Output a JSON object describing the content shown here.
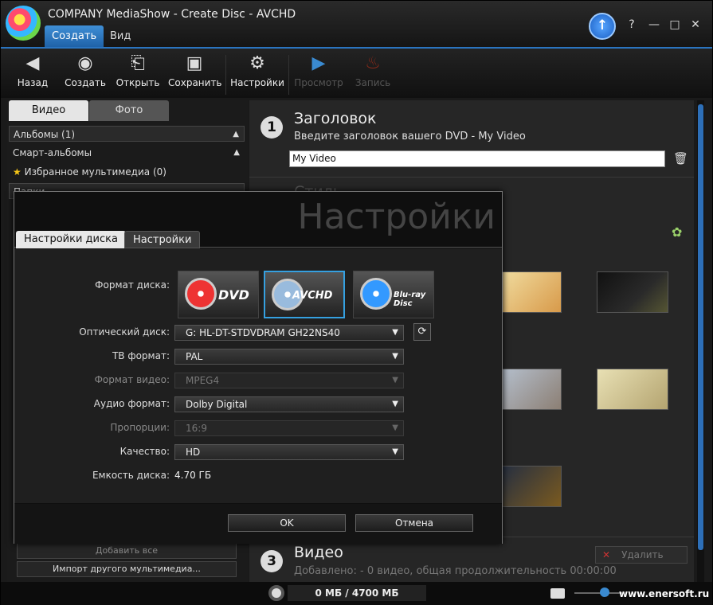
{
  "window": {
    "title": "COMPANY MediaShow - Create Disc - AVCHD",
    "help": "?",
    "minimize": "—",
    "maximize": "□",
    "close": "✕"
  },
  "menu": {
    "tab1": "Создать",
    "tab2": "Вид"
  },
  "toolbar": {
    "back": "Назад",
    "create": "Создать",
    "open": "Открыть",
    "save": "Сохранить",
    "settings": "Настройки",
    "preview": "Просмотр",
    "burn": "Запись"
  },
  "left": {
    "tab_video": "Видео",
    "tab_photo": "Фото",
    "albums": "Альбомы (1)",
    "smart_albums": "Смарт-альбомы",
    "favorites": "Избранное мультимедиа (0)",
    "folders": "Папки",
    "add_all": "Добавить все",
    "import_other": "Импорт другого мультимедиа..."
  },
  "right": {
    "step1_num": "1",
    "step1_title": "Заголовок",
    "step1_sub": "Введите заголовок вашего DVD - My Video",
    "title_value": "My Video",
    "step2_title": "Стиль",
    "step3_num": "3",
    "step3_title": "Видео",
    "step3_sub": "Добавлено: - 0 видео, общая продолжительность 00:00:00",
    "delete": "Удалить"
  },
  "status": {
    "capacity": "0 МБ / 4700 МБ",
    "watermark": "www.enersoft.ru"
  },
  "dialog": {
    "title": "Настройки",
    "tab_disc": "Настройки диска",
    "tab_settings": "Настройки",
    "disc_format_label": "Формат диска:",
    "formats": {
      "dvd": "DVD",
      "avchd": "AVCHD",
      "bluray": "Blu-ray Disc"
    },
    "optical_label": "Оптический диск:",
    "optical_value": "G: HL-DT-STDVDRAM GH22NS40",
    "tv_label": "ТВ формат:",
    "tv_value": "PAL",
    "video_label": "Формат видео:",
    "video_value": "MPEG4",
    "audio_label": "Аудио формат:",
    "audio_value": "Dolby Digital",
    "aspect_label": "Пропорции:",
    "aspect_value": "16:9",
    "quality_label": "Качество:",
    "quality_value": "HD",
    "capacity_label": "Емкость диска:",
    "capacity_value": "4.70 ГБ",
    "ok": "OK",
    "cancel": "Отмена"
  }
}
